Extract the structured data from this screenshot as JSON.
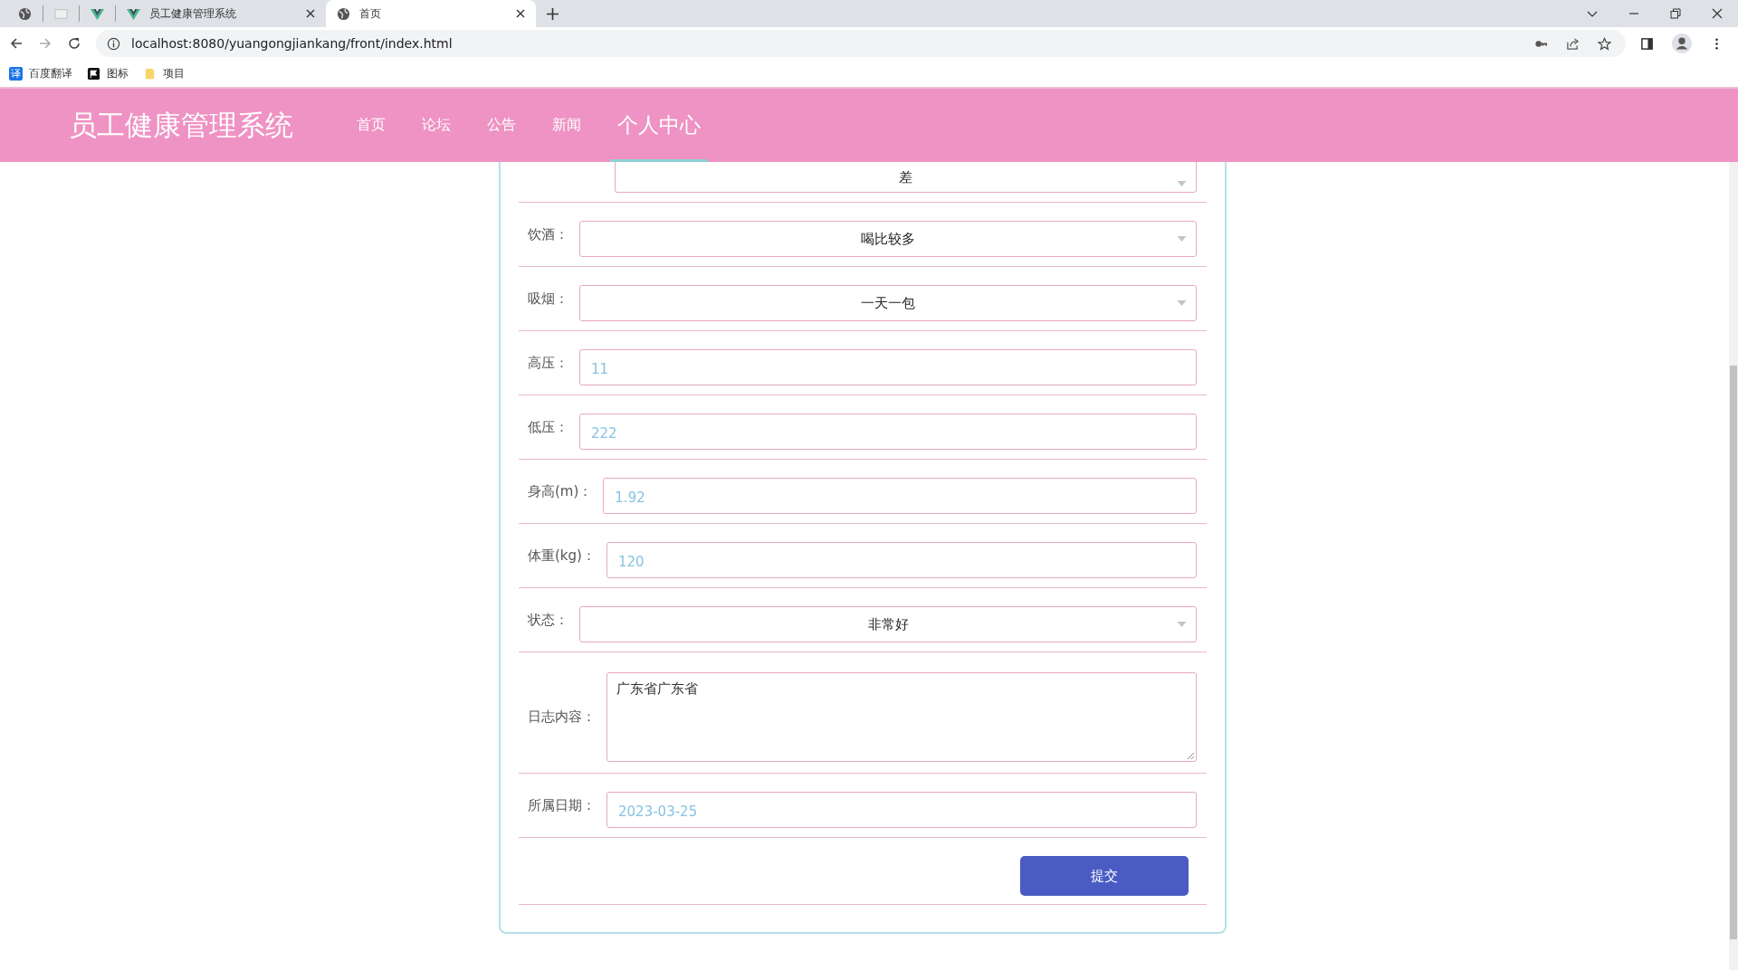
{
  "browser": {
    "tabs": [
      {
        "kind": "globe",
        "selected": false
      },
      {
        "kind": "page",
        "selected": false
      },
      {
        "kind": "vue",
        "selected": false
      },
      {
        "kind": "vue",
        "title": "员工健康管理系统",
        "selected": false
      },
      {
        "kind": "globe",
        "title": "首页",
        "selected": true
      }
    ],
    "url": "localhost:8080/yuangongjiankang/front/index.html",
    "bookmarks": [
      {
        "kind": "translate",
        "icon_text": "译",
        "label": "百度翻译"
      },
      {
        "kind": "flag",
        "label": "图标"
      },
      {
        "kind": "folder",
        "label": "项目"
      }
    ]
  },
  "header": {
    "title": "员工健康管理系统",
    "nav": [
      {
        "label": "首页",
        "selected": false
      },
      {
        "label": "论坛",
        "selected": false
      },
      {
        "label": "公告",
        "selected": false
      },
      {
        "label": "新闻",
        "selected": false
      },
      {
        "label": "个人中心",
        "selected": true
      }
    ]
  },
  "form": {
    "rows": [
      {
        "kind": "select",
        "value": "差"
      },
      {
        "kind": "select",
        "label": "饮酒：",
        "value": "喝比较多"
      },
      {
        "kind": "select",
        "label": "吸烟：",
        "value": "一天一包"
      },
      {
        "kind": "input",
        "label": "高压：",
        "value": "11"
      },
      {
        "kind": "input",
        "label": "低压：",
        "value": "222"
      },
      {
        "kind": "input",
        "label": "身高(m)：",
        "value": "1.92"
      },
      {
        "kind": "input",
        "label": "体重(kg)：",
        "value": "120"
      },
      {
        "kind": "select",
        "label": "状态：",
        "value": "非常好"
      },
      {
        "kind": "textarea",
        "label": "日志内容：",
        "value": "广东省广东省"
      },
      {
        "kind": "input",
        "label": "所属日期：",
        "value": "2023-03-25"
      }
    ],
    "submit": "提交"
  }
}
